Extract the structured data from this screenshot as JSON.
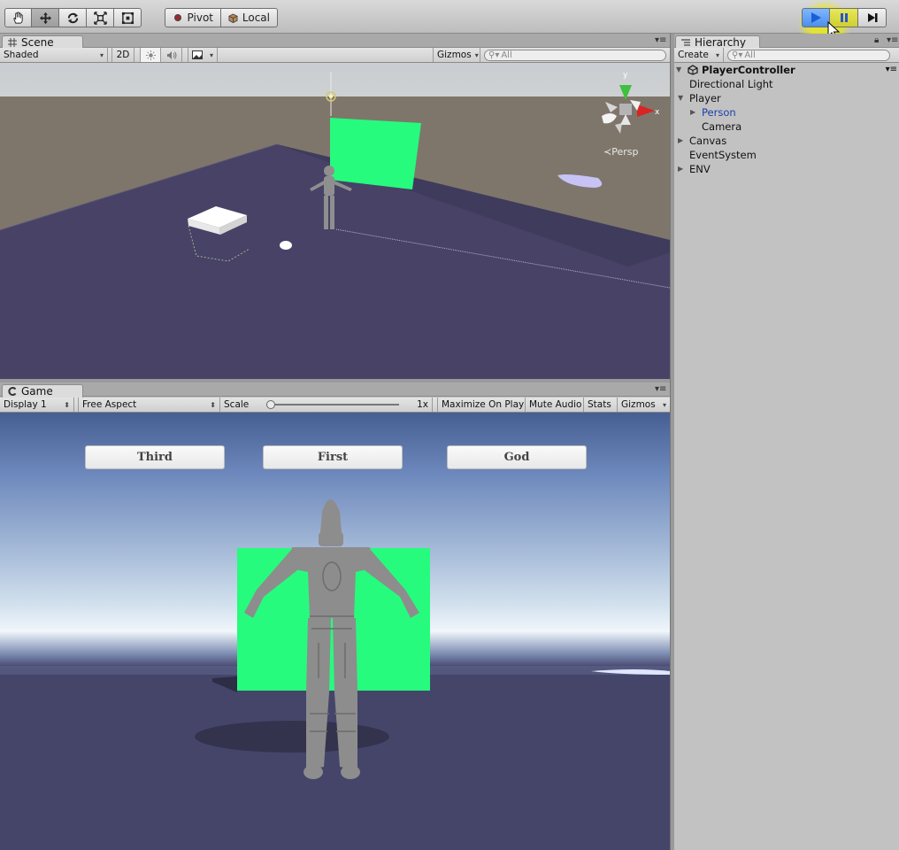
{
  "toolbar": {
    "transform_tools": [
      {
        "icon": "hand-icon",
        "active": false
      },
      {
        "icon": "move-icon",
        "active": true
      },
      {
        "icon": "rotate-icon",
        "active": false
      },
      {
        "icon": "scale-icon",
        "active": false
      },
      {
        "icon": "rect-tool-icon",
        "active": false
      }
    ],
    "pivot_label": "Pivot",
    "local_label": "Local",
    "play_controls": [
      {
        "icon": "play-icon",
        "active": true
      },
      {
        "icon": "pause-icon",
        "active": false
      },
      {
        "icon": "step-icon",
        "active": false
      }
    ],
    "play_color": "#3c8cf0"
  },
  "scene": {
    "tab_label": "Scene",
    "shading_mode": "Shaded",
    "mode_2d": "2D",
    "gizmos_label": "Gizmos",
    "search_placeholder": "All",
    "persp_label": "Persp",
    "axis_labels": {
      "y": "y",
      "x": "x"
    }
  },
  "game": {
    "tab_label": "Game",
    "display": "Display 1",
    "aspect": "Free Aspect",
    "scale_label": "Scale",
    "scale_value": "1x",
    "scale_fraction": 0.0,
    "maximize_label": "Maximize On Play",
    "mute_label": "Mute Audio",
    "stats_label": "Stats",
    "gizmos_label": "Gizmos",
    "buttons": [
      "Third",
      "First",
      "God"
    ],
    "accent_green": "#27fb7d"
  },
  "hierarchy": {
    "tab_label": "Hierarchy",
    "create_label": "Create",
    "search_placeholder": "All",
    "scene_name": "PlayerController",
    "items": [
      {
        "label": "Directional Light",
        "indent": 1,
        "expander": "none",
        "selected": false
      },
      {
        "label": "Player",
        "indent": 1,
        "expander": "open",
        "selected": false
      },
      {
        "label": "Person",
        "indent": 2,
        "expander": "closed",
        "selected": true
      },
      {
        "label": "Camera",
        "indent": 2,
        "expander": "none",
        "selected": false
      },
      {
        "label": "Canvas",
        "indent": 1,
        "expander": "closed",
        "selected": false
      },
      {
        "label": "EventSystem",
        "indent": 1,
        "expander": "none",
        "selected": false
      },
      {
        "label": "ENV",
        "indent": 1,
        "expander": "closed",
        "selected": false
      }
    ]
  }
}
